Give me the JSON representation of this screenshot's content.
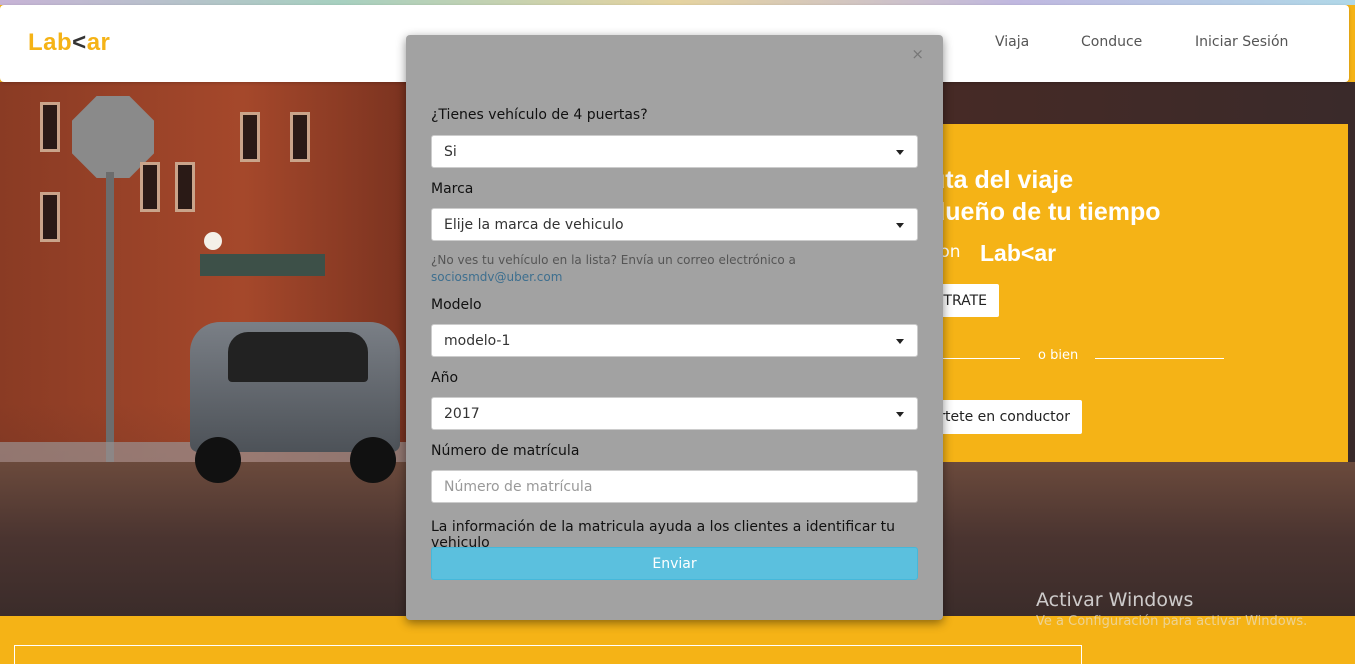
{
  "brand": {
    "logo_left": "Lab",
    "logo_chevron": "<",
    "logo_right": "ar",
    "brand_color": "#f5b316"
  },
  "nav": {
    "items": [
      {
        "label": "Viaja"
      },
      {
        "label": "Conduce"
      },
      {
        "label": "Iniciar Sesión"
      }
    ]
  },
  "promo": {
    "headline_line1": "uta del viaje",
    "headline_line2": "dueño de tu tiempo",
    "con_text": "con",
    "register_label": "TRATE",
    "divider_text": "o bien",
    "driver_label": "ertete en conductor"
  },
  "modal": {
    "close_label": "×",
    "doors_label": "¿Tienes vehículo de 4 puertas?",
    "doors_value": "Si",
    "brand_label": "Marca",
    "brand_value": "Elije la marca de vehiculo",
    "help_text": "¿No ves tu vehículo en la lista? Envía un correo electrónico a",
    "help_email": "sociosmdv@uber.com",
    "model_label": "Modelo",
    "model_value": "modelo-1",
    "year_label": "Año",
    "year_value": "2017",
    "plate_label": "Número de matrícula",
    "plate_placeholder": "Número de matrícula",
    "info_text": "La información de la matricula ayuda a los clientes a identificar tu vehiculo",
    "submit_label": "Enviar"
  },
  "watermark": {
    "title": "Activar Windows",
    "subtitle": "Ve a Configuración para activar Windows."
  },
  "colors": {
    "modal_bg": "#a2a2a2",
    "submit_bg": "#5bc0de",
    "promo_bg": "#f5b316"
  }
}
